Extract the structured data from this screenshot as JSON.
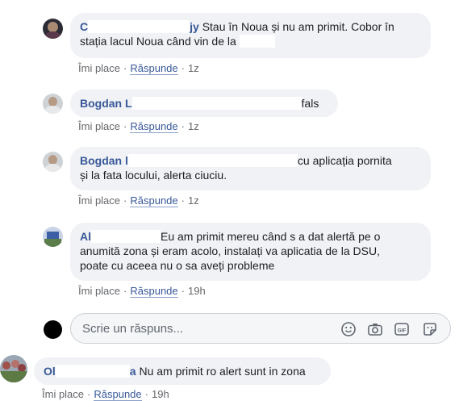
{
  "comments": [
    {
      "author": "C",
      "author_suffix": "jy",
      "text_line1": "Stau în Noua și nu am primit. Cobor în",
      "text_line2": "stația lacul Noua când vin de la",
      "like": "Îmi place",
      "reply": "Răspunde",
      "time": "1z"
    },
    {
      "author": "Bogdan L",
      "text_line1": "fals",
      "like": "Îmi place",
      "reply": "Răspunde",
      "time": "1z"
    },
    {
      "author": "Bogdan l",
      "text_line1": "cu aplicația pornita",
      "text_line2": "și la fata locului, alerta ciuciu.",
      "like": "Îmi place",
      "reply": "Răspunde",
      "time": "1z"
    },
    {
      "author": "Al",
      "text_line1": "Eu am primit mereu când s a dat alertă pe o",
      "text_line2": "anumită zona și eram acolo, instalați va aplicatia de la DSU,",
      "text_line3": "poate cu aceea nu o sa aveți probleme",
      "like": "Îmi place",
      "reply": "Răspunde",
      "time": "19h"
    }
  ],
  "reply_box": {
    "placeholder": "Scrie un răspuns...",
    "icons": [
      "emoji-icon",
      "camera-icon",
      "gif-icon",
      "sticker-icon"
    ]
  },
  "bottom_comment": {
    "author": "Ol",
    "author_suffix": "a",
    "text": "Nu am primit ro alert sunt in zona",
    "like": "Îmi place",
    "reply": "Răspunde",
    "time": "19h"
  },
  "colors": {
    "author": "#385898",
    "bubble": "#f0f2f5",
    "meta": "#65676b"
  }
}
